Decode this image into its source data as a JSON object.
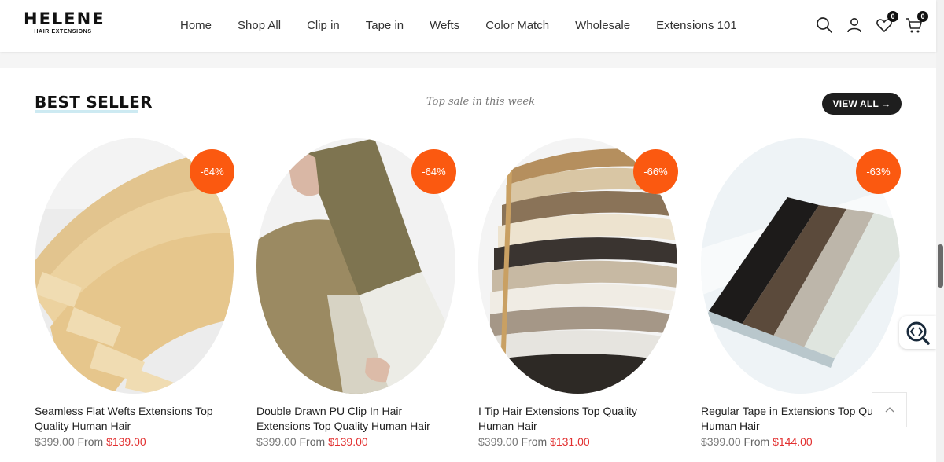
{
  "header": {
    "logo_main": "HELENE",
    "logo_sub": "HAIR EXTENSIONS",
    "nav": [
      "Home",
      "Shop All",
      "Clip in",
      "Tape in",
      "Wefts",
      "Color Match",
      "Wholesale",
      "Extensions 101"
    ],
    "icons": [
      "search-icon",
      "user-icon",
      "heart-icon",
      "cart-icon"
    ],
    "wishlist_count": "0",
    "cart_count": "0"
  },
  "section": {
    "title": "BEST SELLER",
    "subtitle": "Top sale in this week",
    "view_all": "VIEW ALL →"
  },
  "products": [
    {
      "title": "Seamless Flat Wefts Extensions Top Quality Human Hair",
      "discount": "-64%",
      "old_price": "$399.00",
      "from": "From",
      "price": "$139.00"
    },
    {
      "title": "Double Drawn PU Clip In Hair Extensions Top Quality Human Hair",
      "discount": "-64%",
      "old_price": "$399.00",
      "from": "From",
      "price": "$139.00"
    },
    {
      "title": "I Tip Hair Extensions Top Quality Human Hair",
      "discount": "-66%",
      "old_price": "$399.00",
      "from": "From",
      "price": "$131.00"
    },
    {
      "title": "Regular Tape in Extensions Top Quality Human Hair",
      "discount": "-63%",
      "old_price": "$399.00",
      "from": "From",
      "price": "$144.00"
    }
  ],
  "colors": {
    "accent": "#fb5910",
    "sale": "#e23030",
    "button": "#1e1e1e"
  }
}
